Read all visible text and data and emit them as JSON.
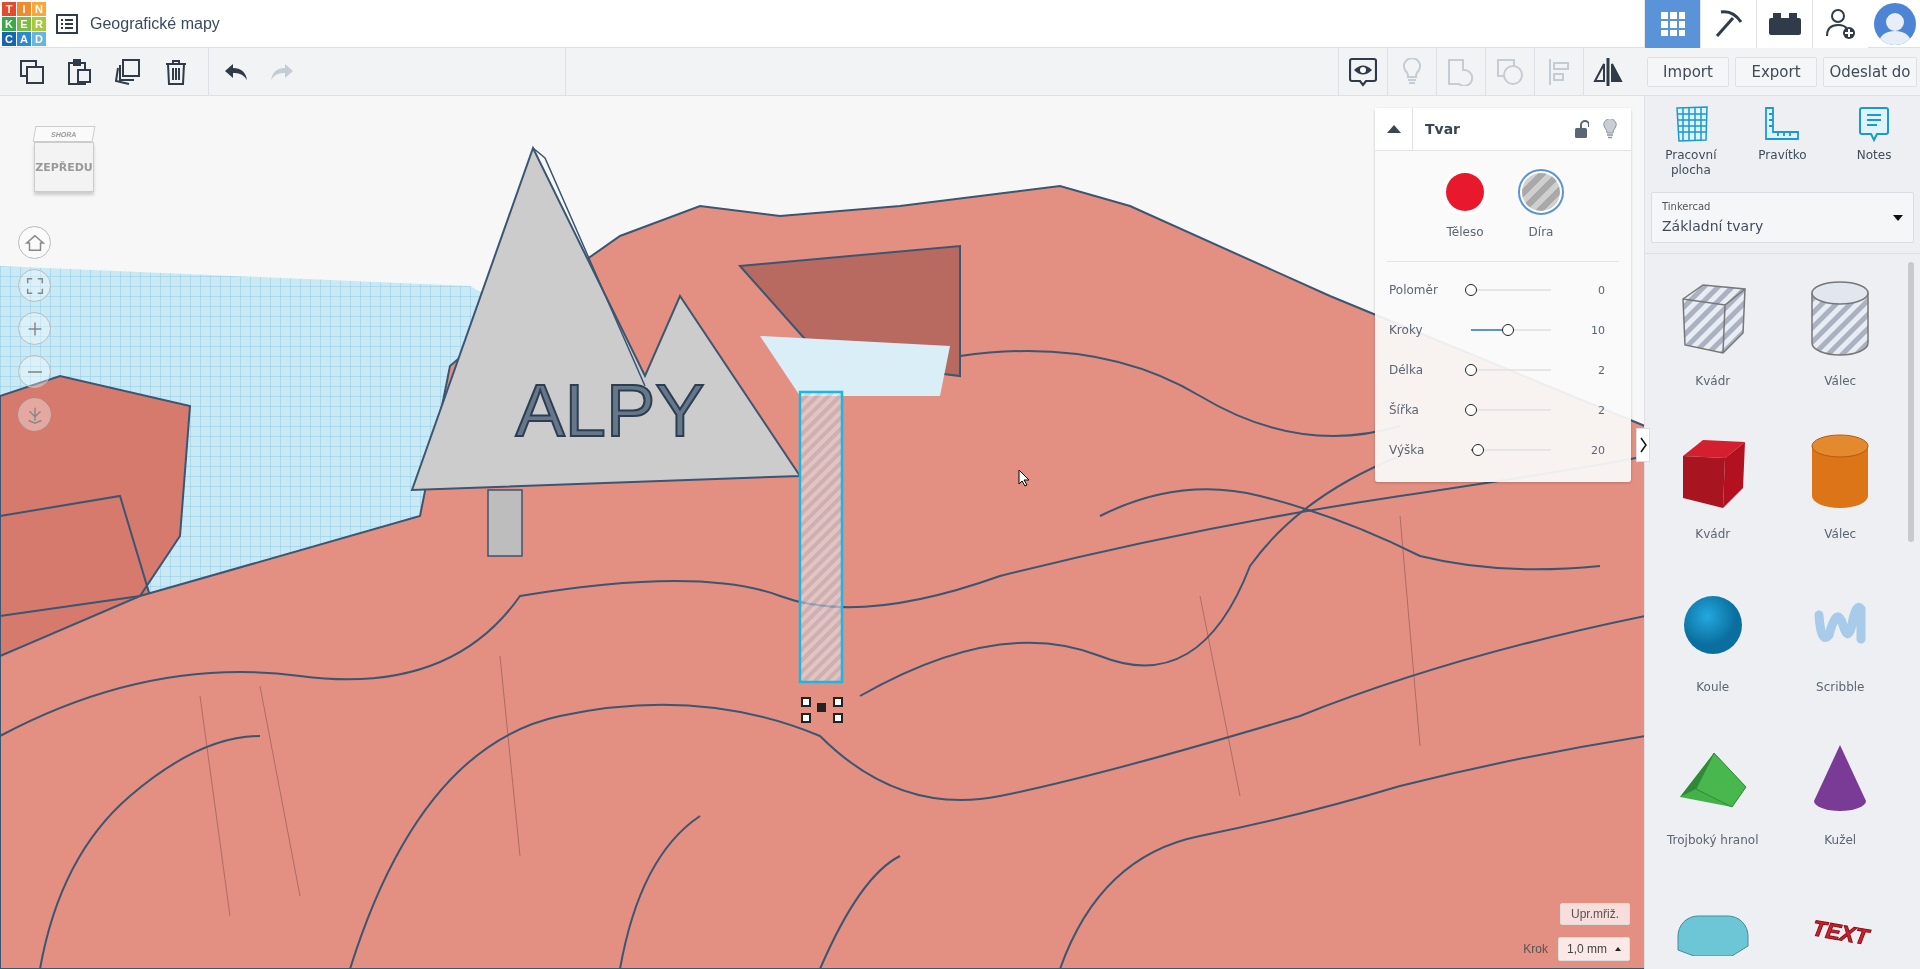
{
  "app_bar": {
    "logo_letters": [
      "T",
      "I",
      "N",
      "K",
      "E",
      "R",
      "C",
      "A",
      "D"
    ],
    "title": "Geografické mapy",
    "views": [
      {
        "kind": "grid",
        "selected": true
      },
      {
        "kind": "pickaxe",
        "selected": false
      },
      {
        "kind": "bricks",
        "selected": false
      }
    ]
  },
  "toolbar": {
    "edit_tools": [
      {
        "kind": "copy",
        "disabled": false
      },
      {
        "kind": "paste",
        "disabled": false
      },
      {
        "kind": "duplicate",
        "disabled": false
      },
      {
        "kind": "delete",
        "disabled": false
      }
    ],
    "history_tools": [
      {
        "kind": "undo",
        "disabled": false
      },
      {
        "kind": "redo",
        "disabled": true
      }
    ],
    "view_tools": [
      {
        "kind": "notes",
        "disabled": false
      },
      {
        "kind": "bulb",
        "disabled": true
      },
      {
        "kind": "group",
        "disabled": true
      },
      {
        "kind": "ungroup",
        "disabled": true
      },
      {
        "kind": "align",
        "disabled": true
      },
      {
        "kind": "mirror",
        "disabled": false
      }
    ],
    "buttons": [
      "Import",
      "Export",
      "Odeslat do"
    ]
  },
  "view_cube": {
    "top": "SHORA",
    "front": "ZEPŘEDU"
  },
  "scene": {
    "sign_text": "ALPY"
  },
  "shape_panel": {
    "title": "Tvar",
    "modes": [
      {
        "kind": "solid",
        "label": "Těleso",
        "selected": false
      },
      {
        "kind": "hole",
        "label": "Díra",
        "selected": true
      }
    ],
    "params": [
      {
        "label": "Poloměr",
        "level": 0,
        "reading": "0"
      },
      {
        "label": "Kroky",
        "level": 0.46,
        "reading": "10"
      },
      {
        "label": "Délka",
        "level": 0,
        "reading": "2"
      },
      {
        "label": "Šířka",
        "level": 0,
        "reading": "2"
      },
      {
        "label": "Výška",
        "level": 0.09,
        "reading": "20"
      }
    ]
  },
  "grid_controls": {
    "edit_button": "Upr.mřiž.",
    "step_label": "Krok",
    "step_value": "1,0 mm"
  },
  "sidebar": {
    "tools": [
      {
        "kind": "workplane",
        "label": "Pracovní plocha"
      },
      {
        "kind": "ruler",
        "label": "Pravítko"
      },
      {
        "kind": "notes",
        "label": "Notes"
      }
    ],
    "library": {
      "label": "Tinkercad",
      "value": "Základní tvary"
    },
    "shapes": [
      {
        "kind": "box-hole",
        "label": "Kvádr"
      },
      {
        "kind": "cylinder-hole",
        "label": "Válec"
      },
      {
        "kind": "box",
        "label": "Kvádr"
      },
      {
        "kind": "cylinder",
        "label": "Válec"
      },
      {
        "kind": "sphere",
        "label": "Koule"
      },
      {
        "kind": "scribble",
        "label": "Scribble"
      },
      {
        "kind": "prism",
        "label": "Trojboký hranol"
      },
      {
        "kind": "cone",
        "label": "Kužel"
      },
      {
        "kind": "roof"
      },
      {
        "kind": "text",
        "thumbnail_text": "TEXT"
      }
    ]
  }
}
